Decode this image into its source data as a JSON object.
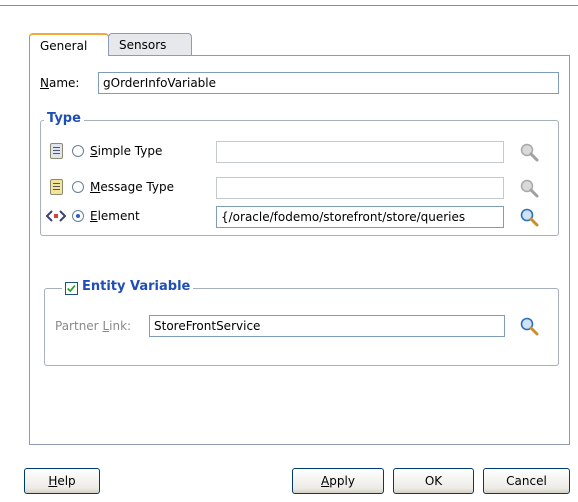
{
  "tabs": [
    {
      "label": "General",
      "active": true
    },
    {
      "label": "Sensors",
      "active": false
    }
  ],
  "name": {
    "label_mnemonic": "N",
    "label_rest": "ame:",
    "value": "gOrderInfoVariable"
  },
  "type_group": {
    "legend": "Type",
    "options": [
      {
        "mnemonic": "S",
        "rest": "imple Type",
        "selected": false,
        "value": "",
        "icon": "simple-type-icon",
        "search_enabled": false
      },
      {
        "mnemonic": "M",
        "rest": "essage Type",
        "selected": false,
        "value": "",
        "icon": "message-type-icon",
        "search_enabled": false
      },
      {
        "mnemonic": "E",
        "rest": "lement",
        "selected": true,
        "value": "{/oracle/fodemo/storefront/store/queries",
        "icon": "element-icon",
        "search_enabled": true
      }
    ]
  },
  "entity_variable": {
    "checked": true,
    "legend": "Entity Variable",
    "partner_link_label_pre": "Partner ",
    "partner_link_label_mnemonic": "L",
    "partner_link_label_post": "ink:",
    "partner_link_value": "StoreFrontService"
  },
  "buttons": {
    "help_mnemonic": "H",
    "help_rest": "elp",
    "apply_mnemonic": "A",
    "apply_rest": "pply",
    "ok": "OK",
    "cancel": "Cancel"
  },
  "colors": {
    "accent_blue": "#1f4fb4",
    "tab_highlight": "#f3a73c"
  }
}
